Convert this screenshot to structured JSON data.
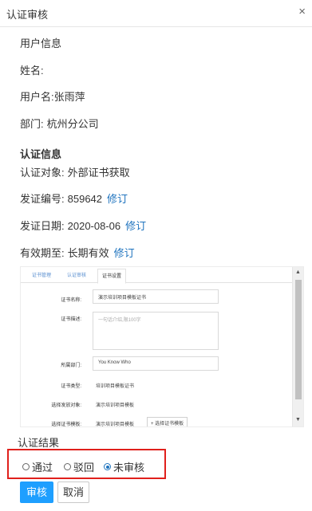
{
  "dialog": {
    "title": "认证审核",
    "close_icon": "×"
  },
  "user_info": {
    "heading": "用户信息",
    "name_label": "姓名:",
    "username_label": "用户名:",
    "username_value": "张雨萍",
    "dept_label": "部门:",
    "dept_value": "杭州分公司"
  },
  "cert_info": {
    "heading": "认证信息",
    "target_label": "认证对象:",
    "target_value": "外部证书获取",
    "number_label": "发证编号:",
    "number_value": "859642",
    "date_label": "发证日期:",
    "date_value": "2020-08-06",
    "validity_label": "有效期至:",
    "validity_value": "长期有效",
    "edit_label": "修订"
  },
  "preview": {
    "tabs": [
      "证书管理",
      "认证审核",
      "证书设置"
    ],
    "active_tab": 2,
    "fields": {
      "name_label": "证书名称:",
      "name_value": "演示培训项目模板证书",
      "desc_label": "证书描述:",
      "desc_placeholder": "一句话介绍,限100字",
      "dept_label": "所属部门:",
      "dept_value": "You Know Who",
      "type_label": "证书类型:",
      "type_value": "培训项目模板证书",
      "issue_label": "选择发放对象:",
      "issue_value": "演示培训项目模板",
      "template_label": "选择证书模板:",
      "template_value": "演示培训项目模板",
      "template_button": "+ 选择证书模板"
    },
    "scroll_up": "▲",
    "scroll_down": "▼"
  },
  "result": {
    "heading": "认证结果",
    "options": [
      "通过",
      "驳回",
      "未审核"
    ],
    "selected": 2
  },
  "actions": {
    "approve": "审核",
    "cancel": "取消"
  },
  "colors": {
    "accent": "#1e9fff",
    "link": "#1e73be",
    "highlight_border": "#e0201c"
  }
}
